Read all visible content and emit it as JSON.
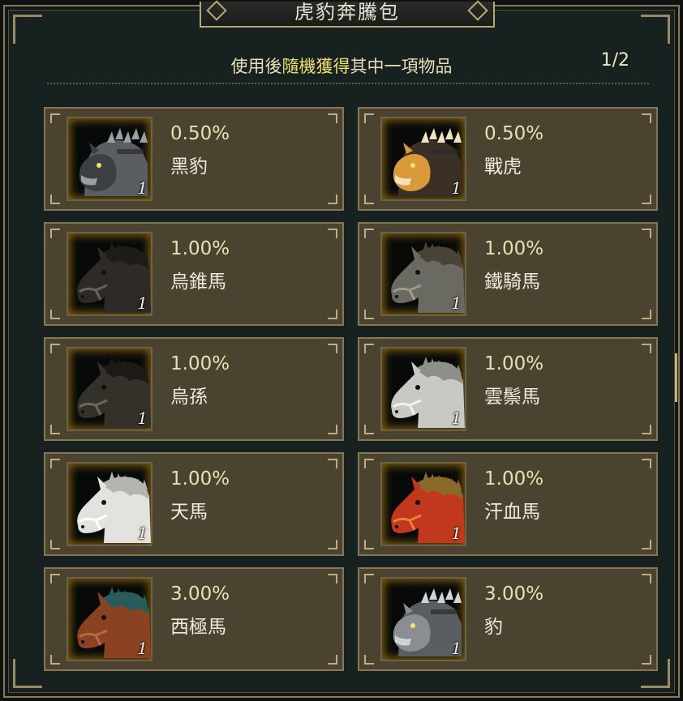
{
  "title": "虎豹奔騰包",
  "subtitle_prefix": "使用後",
  "subtitle_highlight": "隨機獲得",
  "subtitle_suffix": "其中一項物品",
  "page_indicator": "1/2",
  "items": [
    {
      "percent": "0.50%",
      "name": "黑豹",
      "quantity": "1",
      "icon": "armored-panther-icon",
      "colors": {
        "body": "#3c4044",
        "mane": "#5a5e62",
        "accent": "#9aa0a6"
      }
    },
    {
      "percent": "0.50%",
      "name": "戰虎",
      "quantity": "1",
      "icon": "armored-tiger-icon",
      "colors": {
        "body": "#d89a3a",
        "mane": "#3a3026",
        "accent": "#f0e2c0"
      }
    },
    {
      "percent": "1.00%",
      "name": "烏錐馬",
      "quantity": "1",
      "icon": "black-horse-icon",
      "colors": {
        "body": "#2e2a26",
        "mane": "#1e1c1a",
        "accent": "#6a6258"
      }
    },
    {
      "percent": "1.00%",
      "name": "鐵騎馬",
      "quantity": "1",
      "icon": "iron-cavalry-horse-icon",
      "colors": {
        "body": "#6a6a62",
        "mane": "#4a4438",
        "accent": "#9e9a88"
      }
    },
    {
      "percent": "1.00%",
      "name": "烏孫",
      "quantity": "1",
      "icon": "dark-horse-icon",
      "colors": {
        "body": "#34302a",
        "mane": "#1c1a18",
        "accent": "#6e665a"
      }
    },
    {
      "percent": "1.00%",
      "name": "雲鬃馬",
      "quantity": "1",
      "icon": "white-grey-horse-icon",
      "colors": {
        "body": "#c8c8c4",
        "mane": "#8e8e8a",
        "accent": "#f0f0ec"
      }
    },
    {
      "percent": "1.00%",
      "name": "天馬",
      "quantity": "1",
      "icon": "white-horse-icon",
      "colors": {
        "body": "#e2e2de",
        "mane": "#b4b4b0",
        "accent": "#ffffff"
      }
    },
    {
      "percent": "1.00%",
      "name": "汗血馬",
      "quantity": "1",
      "icon": "red-horse-icon",
      "colors": {
        "body": "#c2381e",
        "mane": "#8a6a2a",
        "accent": "#e8803a"
      }
    },
    {
      "percent": "3.00%",
      "name": "西極馬",
      "quantity": "1",
      "icon": "brown-horse-icon",
      "colors": {
        "body": "#8a4222",
        "mane": "#2a5a5a",
        "accent": "#b86a3a"
      }
    },
    {
      "percent": "3.00%",
      "name": "豹",
      "quantity": "1",
      "icon": "armored-leopard-icon",
      "colors": {
        "body": "#8a8e92",
        "mane": "#5a5e62",
        "accent": "#d0d4d8"
      }
    }
  ]
}
